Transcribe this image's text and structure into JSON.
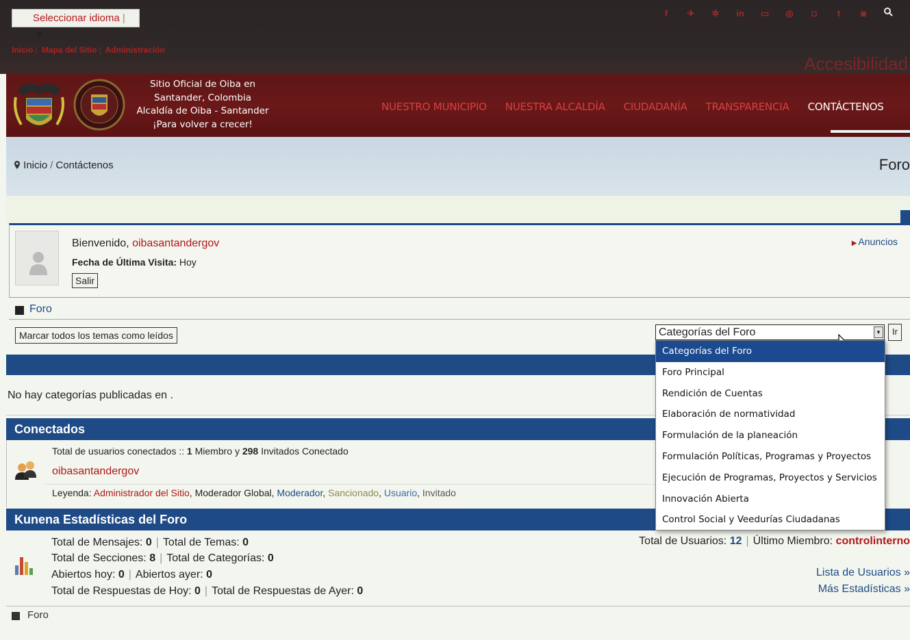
{
  "topbar": {
    "language_select": "Seleccionar idioma",
    "language_arrow": "▼",
    "social_icons": [
      "f",
      "t",
      "g+",
      "in",
      "yt",
      "in2",
      "ig",
      "t2",
      "fl"
    ],
    "social_glyphs": [
      "f",
      "✈",
      "✲",
      "in",
      "▭",
      "◎",
      "◘",
      "t",
      "◙"
    ],
    "search_glyph": "🔍",
    "links": [
      "Inicio",
      "Mapa del Sitio",
      "Administración"
    ],
    "accessibility": "Accesibilidad"
  },
  "header": {
    "tagline": [
      "Sitio Oficial de Oiba en",
      "Santander, Colombia",
      "Alcaldía de Oiba - Santander",
      "¡Para volver a crecer!"
    ],
    "nav": [
      "NUESTRO MUNICIPIO",
      "NUESTRA ALCALDÍA",
      "CIUDADANÍA",
      "TRANSPARENCIA",
      "CONTÁCTENOS"
    ]
  },
  "breadcrumb": {
    "items": [
      "Inicio",
      "Contáctenos"
    ],
    "separator": "/",
    "title": "Foro"
  },
  "welcome": {
    "greeting": "Bienvenido,",
    "user": "oibasantandergov",
    "last_visit_label": "Fecha de Última Visita:",
    "last_visit_value": "Hoy",
    "logout": "Salir",
    "announcements": "Anuncios"
  },
  "forum": {
    "label": "Foro",
    "mark_all_read": "Marcar todos los temas como leídos",
    "category_select": "Categorías del Foro",
    "go_button": "Ir",
    "no_categories": "No hay categorías publicadas en ."
  },
  "dropdown": {
    "options": [
      "Categorías del Foro",
      "Foro Principal",
      "Rendición de Cuentas",
      "Elaboración de normatividad",
      "Formulación de la planeación",
      "Formulación Políticas, Programas y Proyectos",
      "Ejecución de Programas, Proyectos y Servicios",
      "Innovación Abierta",
      "Control Social y Veedurías Ciudadanas"
    ],
    "selected_index": 0
  },
  "online": {
    "title": "Conectados",
    "total_text_a": "Total de usuarios conectados ::",
    "members": "1",
    "members_label": "Miembro y",
    "guests": "298",
    "guests_label": "Invitados Conectado",
    "user": "oibasantandergov",
    "legend_label": "Leyenda:",
    "legend": [
      "Administrador del Sitio",
      "Moderador Global",
      "Moderador",
      "Sancionado",
      "Usuario",
      "Invitado"
    ]
  },
  "stats": {
    "title": "Kunena Estadísticas del Foro",
    "messages_label": "Total de Mensajes:",
    "messages": "0",
    "topics_label": "Total de Temas:",
    "topics": "0",
    "sections_label": "Total de Secciones:",
    "sections": "8",
    "categories_label": "Total de Categorías:",
    "categories": "0",
    "open_today_label": "Abiertos hoy:",
    "open_today": "0",
    "open_yesterday_label": "Abiertos ayer:",
    "open_yesterday": "0",
    "replies_today_label": "Total de Respuestas de Hoy:",
    "replies_today": "0",
    "replies_yesterday_label": "Total de Respuestas de Ayer:",
    "replies_yesterday": "0",
    "users_label": "Total de Usuarios:",
    "users": "12",
    "last_member_label": "Último Miembro:",
    "last_member": "controlinterno",
    "user_list_link": "Lista de Usuarios »",
    "more_stats_link": "Más Estadísticas »"
  },
  "footer": {
    "label": "Foro"
  },
  "colors": {
    "brand_red": "#b01818",
    "brand_blue": "#1e4a86",
    "banner": "#5e1616"
  }
}
